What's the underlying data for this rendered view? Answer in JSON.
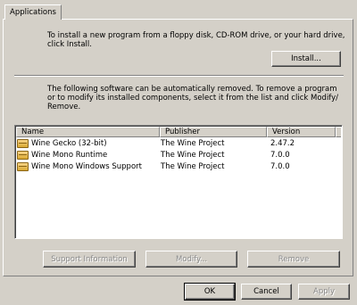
{
  "tabs": [
    {
      "label": "Applications"
    }
  ],
  "install_section": {
    "description": "To install a new program from a floppy disk, CD-ROM drive, or your hard drive, click Install.",
    "install_button": "Install..."
  },
  "remove_section": {
    "description": "The following software can be automatically removed. To remove a program or to modify its installed components, select it from the list and click Modify/ Remove."
  },
  "list": {
    "columns": [
      "Name",
      "Publisher",
      "Version"
    ],
    "rows": [
      {
        "name": "Wine Gecko (32-bit)",
        "publisher": "The Wine Project",
        "version": "2.47.2",
        "icon": "package-icon"
      },
      {
        "name": "Wine Mono Runtime",
        "publisher": "The Wine Project",
        "version": "7.0.0",
        "icon": "package-icon"
      },
      {
        "name": "Wine Mono Windows Support",
        "publisher": "The Wine Project",
        "version": "7.0.0",
        "icon": "package-icon"
      }
    ]
  },
  "actions": {
    "support_info": "Support Information",
    "modify": "Modify...",
    "remove": "Remove"
  },
  "dialog_buttons": {
    "ok": "OK",
    "cancel": "Cancel",
    "apply": "Apply"
  }
}
